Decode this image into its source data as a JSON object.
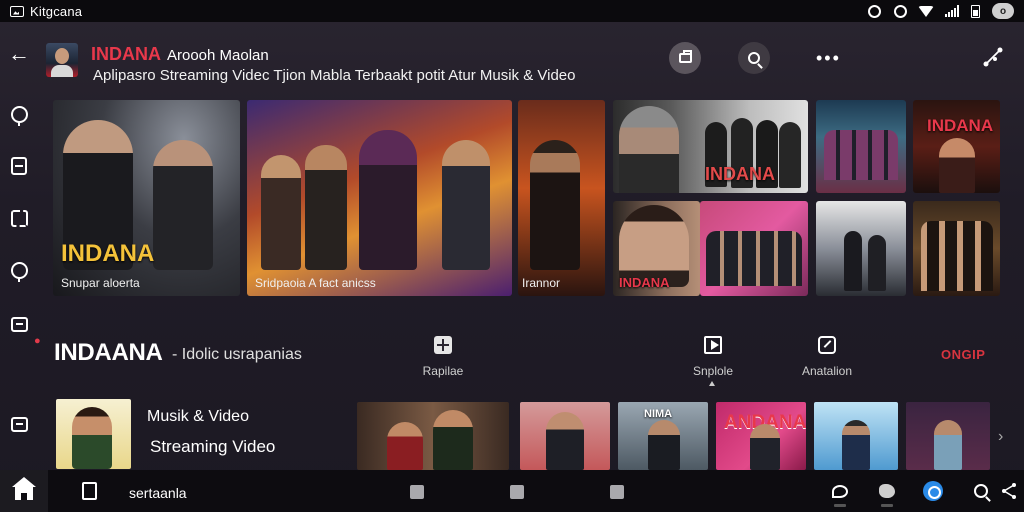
{
  "status_bar": {
    "app_name": "Kitgcana",
    "toggle_label": "o"
  },
  "header": {
    "brand": "INDANA",
    "subtitle": "Aroooh Maolan",
    "tagline": "Aplipasro Streaming Videc Tjion Mabla Terbaakt potit Atur Musik & Video"
  },
  "featured": [
    {
      "label": "Snupar aloerta",
      "brand": "INDANA"
    },
    {
      "label": "Sridpaoia A fact anicss"
    },
    {
      "label": "Irannor"
    },
    {
      "brand": "INDANA"
    },
    {
      "brand": "INDANA"
    },
    {
      "brand": "INDANA"
    }
  ],
  "section": {
    "title": "INDAANA",
    "subtitle": "- Idolic usrapanias",
    "actions": [
      {
        "label": "Rapilae",
        "icon": "add-icon"
      },
      {
        "label": "Snplole",
        "icon": "play-icon"
      },
      {
        "label": "Anatalion",
        "icon": "edit-icon"
      }
    ],
    "link": "ONGIP"
  },
  "song": {
    "title": "Musik & Video",
    "subtitle": "Streaming Video"
  },
  "row_thumbs": [
    "",
    "",
    "NIMA",
    "ANDANA",
    "",
    ""
  ],
  "bottom_nav": {
    "label": "sertaanla",
    "items": [
      "home-icon",
      "document-icon",
      "square-1",
      "square-2",
      "square-3",
      "chat-icon",
      "bird-icon",
      "active-icon",
      "search-icon",
      "share-icon"
    ]
  },
  "colors": {
    "accent": "#e8384b",
    "brand_yellow": "#f4c23a",
    "active_blue": "#2a8be8"
  }
}
